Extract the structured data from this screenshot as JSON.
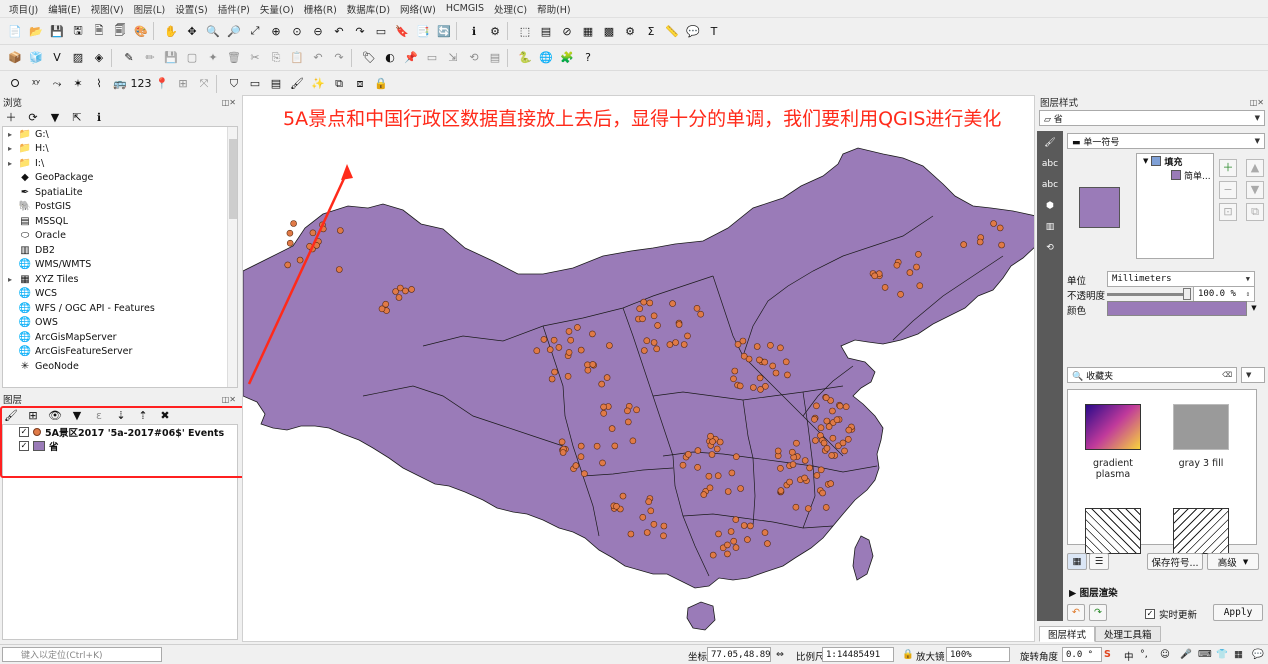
{
  "menu": [
    "项目(J)",
    "编辑(E)",
    "视图(V)",
    "图层(L)",
    "设置(S)",
    "插件(P)",
    "矢量(O)",
    "栅格(R)",
    "数据库(D)",
    "网络(W)",
    "HCMGIS",
    "处理(C)",
    "帮助(H)"
  ],
  "browser": {
    "title": "浏览",
    "items": [
      {
        "label": "G:\\",
        "icon": "folder-icon",
        "expand": true
      },
      {
        "label": "H:\\",
        "icon": "folder-icon",
        "expand": true
      },
      {
        "label": "I:\\",
        "icon": "folder-icon",
        "expand": true
      },
      {
        "label": "GeoPackage",
        "icon": "geopackage-icon",
        "expand": false
      },
      {
        "label": "SpatiaLite",
        "icon": "spatialite-icon",
        "expand": false
      },
      {
        "label": "PostGIS",
        "icon": "postgis-icon",
        "expand": false
      },
      {
        "label": "MSSQL",
        "icon": "mssql-icon",
        "expand": false
      },
      {
        "label": "Oracle",
        "icon": "oracle-icon",
        "expand": false
      },
      {
        "label": "DB2",
        "icon": "db2-icon",
        "expand": false
      },
      {
        "label": "WMS/WMTS",
        "icon": "globe-icon",
        "expand": false
      },
      {
        "label": "XYZ Tiles",
        "icon": "tiles-icon",
        "expand": true
      },
      {
        "label": "WCS",
        "icon": "globe-icon",
        "expand": false
      },
      {
        "label": "WFS / OGC API - Features",
        "icon": "globe-icon",
        "expand": false
      },
      {
        "label": "OWS",
        "icon": "globe-icon",
        "expand": false
      },
      {
        "label": "ArcGisMapServer",
        "icon": "globe-icon",
        "expand": false
      },
      {
        "label": "ArcGisFeatureServer",
        "icon": "globe-icon",
        "expand": false
      },
      {
        "label": "GeoNode",
        "icon": "geonode-icon",
        "expand": false
      }
    ]
  },
  "layers": {
    "title": "图层",
    "items": [
      {
        "label": "5A景区2017 '5a-2017#06$' Events",
        "checked": true,
        "symbol": "point"
      },
      {
        "label": "省",
        "checked": true,
        "symbol": "fill"
      }
    ]
  },
  "map": {
    "annotation": "5A景点和中国行政区数据直接放上去后，显得十分的单调，我们要利用QGIS进行美化",
    "fill_color": "#9a7bb8",
    "point_color": "#e07a47"
  },
  "style_panel": {
    "title": "图层样式",
    "layer_select": "省",
    "renderer": "单一符号",
    "tree_fill": "填充",
    "tree_simple": "简单...",
    "unit_label": "单位",
    "unit_value": "Millimeters",
    "opacity_label": "不透明度",
    "opacity_value": "100.0 %",
    "color_label": "颜色",
    "search_placeholder": "收藏夹",
    "favorites": [
      {
        "label": "gradient plasma"
      },
      {
        "label": "gray 3 fill"
      },
      {
        "label": ""
      },
      {
        "label": ""
      }
    ],
    "save_symbol": "保存符号...",
    "advanced": "高级",
    "layer_render": "图层渲染",
    "live_update": "实时更新",
    "apply": "Apply",
    "tab_style": "图层样式",
    "tab_processing": "处理工具箱"
  },
  "status": {
    "locator_placeholder": "键入以定位(Ctrl+K)",
    "coord_label": "坐标",
    "coord_value": "77.05,48.89",
    "scale_label": "比例尺",
    "scale_value": "1:14485491",
    "magnifier_label": "放大镜",
    "magnifier_value": "100%",
    "rotation_label": "旋转角度",
    "rotation_value": "0.0 °"
  }
}
